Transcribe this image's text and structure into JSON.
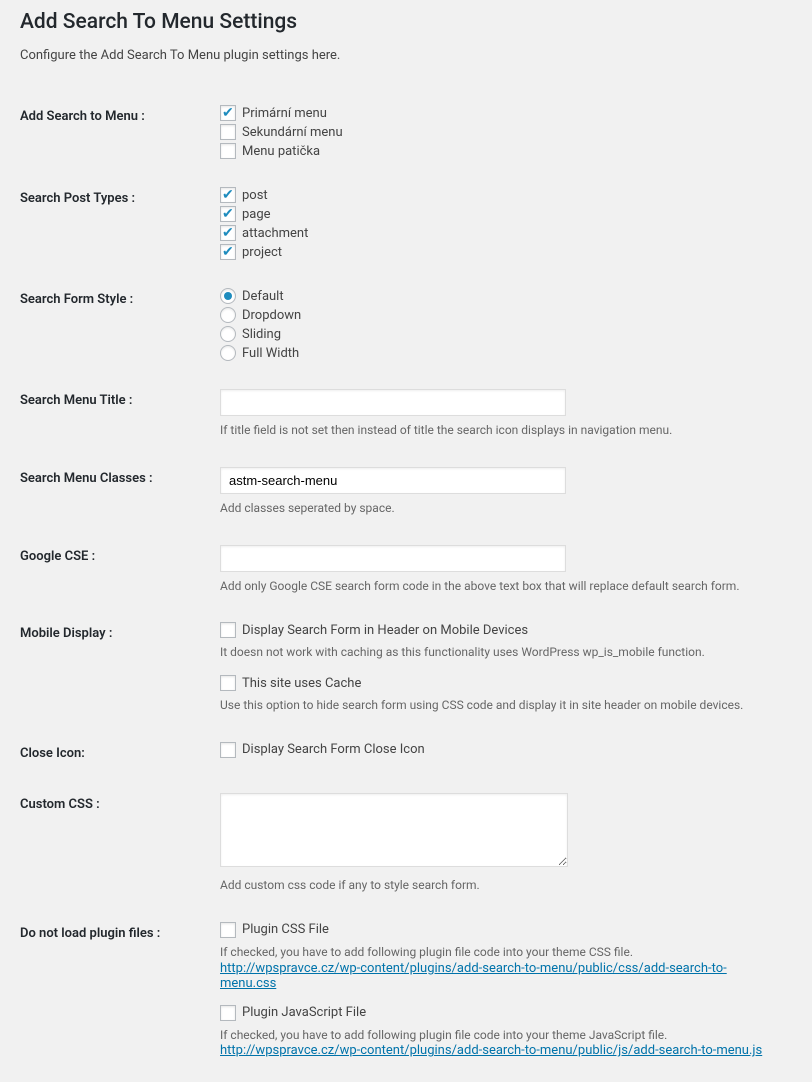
{
  "page": {
    "title": "Add Search To Menu Settings",
    "intro": "Configure the Add Search To Menu plugin settings here."
  },
  "fields": {
    "add_search_to_menu": {
      "label": "Add Search to Menu :",
      "options": [
        {
          "label": "Primární menu",
          "checked": true
        },
        {
          "label": "Sekundární menu",
          "checked": false
        },
        {
          "label": "Menu patička",
          "checked": false
        }
      ]
    },
    "search_post_types": {
      "label": "Search Post Types :",
      "options": [
        {
          "label": "post",
          "checked": true
        },
        {
          "label": "page",
          "checked": true
        },
        {
          "label": "attachment",
          "checked": true
        },
        {
          "label": "project",
          "checked": true
        }
      ]
    },
    "search_form_style": {
      "label": "Search Form Style :",
      "options": [
        {
          "label": "Default",
          "checked": true
        },
        {
          "label": "Dropdown",
          "checked": false
        },
        {
          "label": "Sliding",
          "checked": false
        },
        {
          "label": "Full Width",
          "checked": false
        }
      ]
    },
    "search_menu_title": {
      "label": "Search Menu Title :",
      "value": "",
      "description": "If title field is not set then instead of title the search icon displays in navigation menu."
    },
    "search_menu_classes": {
      "label": "Search Menu Classes :",
      "value": "astm-search-menu",
      "description": "Add classes seperated by space."
    },
    "google_cse": {
      "label": "Google CSE :",
      "value": "",
      "description": "Add only Google CSE search form code in the above text box that will replace default search form."
    },
    "mobile_display": {
      "label": "Mobile Display :",
      "option1": {
        "label": "Display Search Form in Header on Mobile Devices",
        "checked": false
      },
      "desc1": "It doesn not work with caching as this functionality uses WordPress wp_is_mobile function.",
      "option2": {
        "label": "This site uses Cache",
        "checked": false
      },
      "desc2": "Use this option to hide search form using CSS code and display it in site header on mobile devices."
    },
    "close_icon": {
      "label": "Close Icon:",
      "option": {
        "label": "Display Search Form Close Icon",
        "checked": false
      }
    },
    "custom_css": {
      "label": "Custom CSS :",
      "value": "",
      "description": "Add custom css code if any to style search form."
    },
    "do_not_load": {
      "label": "Do not load plugin files :",
      "css_option": {
        "label": "Plugin CSS File",
        "checked": false
      },
      "css_desc": "If checked, you have to add following plugin file code into your theme CSS file.",
      "css_link": "http://wpspravce.cz/wp-content/plugins/add-search-to-menu/public/css/add-search-to-menu.css",
      "js_option": {
        "label": "Plugin JavaScript File",
        "checked": false
      },
      "js_desc": "If checked, you have to add following plugin file code into your theme JavaScript file.",
      "js_link": "http://wpspravce.cz/wp-content/plugins/add-search-to-menu/public/js/add-search-to-menu.js"
    }
  }
}
